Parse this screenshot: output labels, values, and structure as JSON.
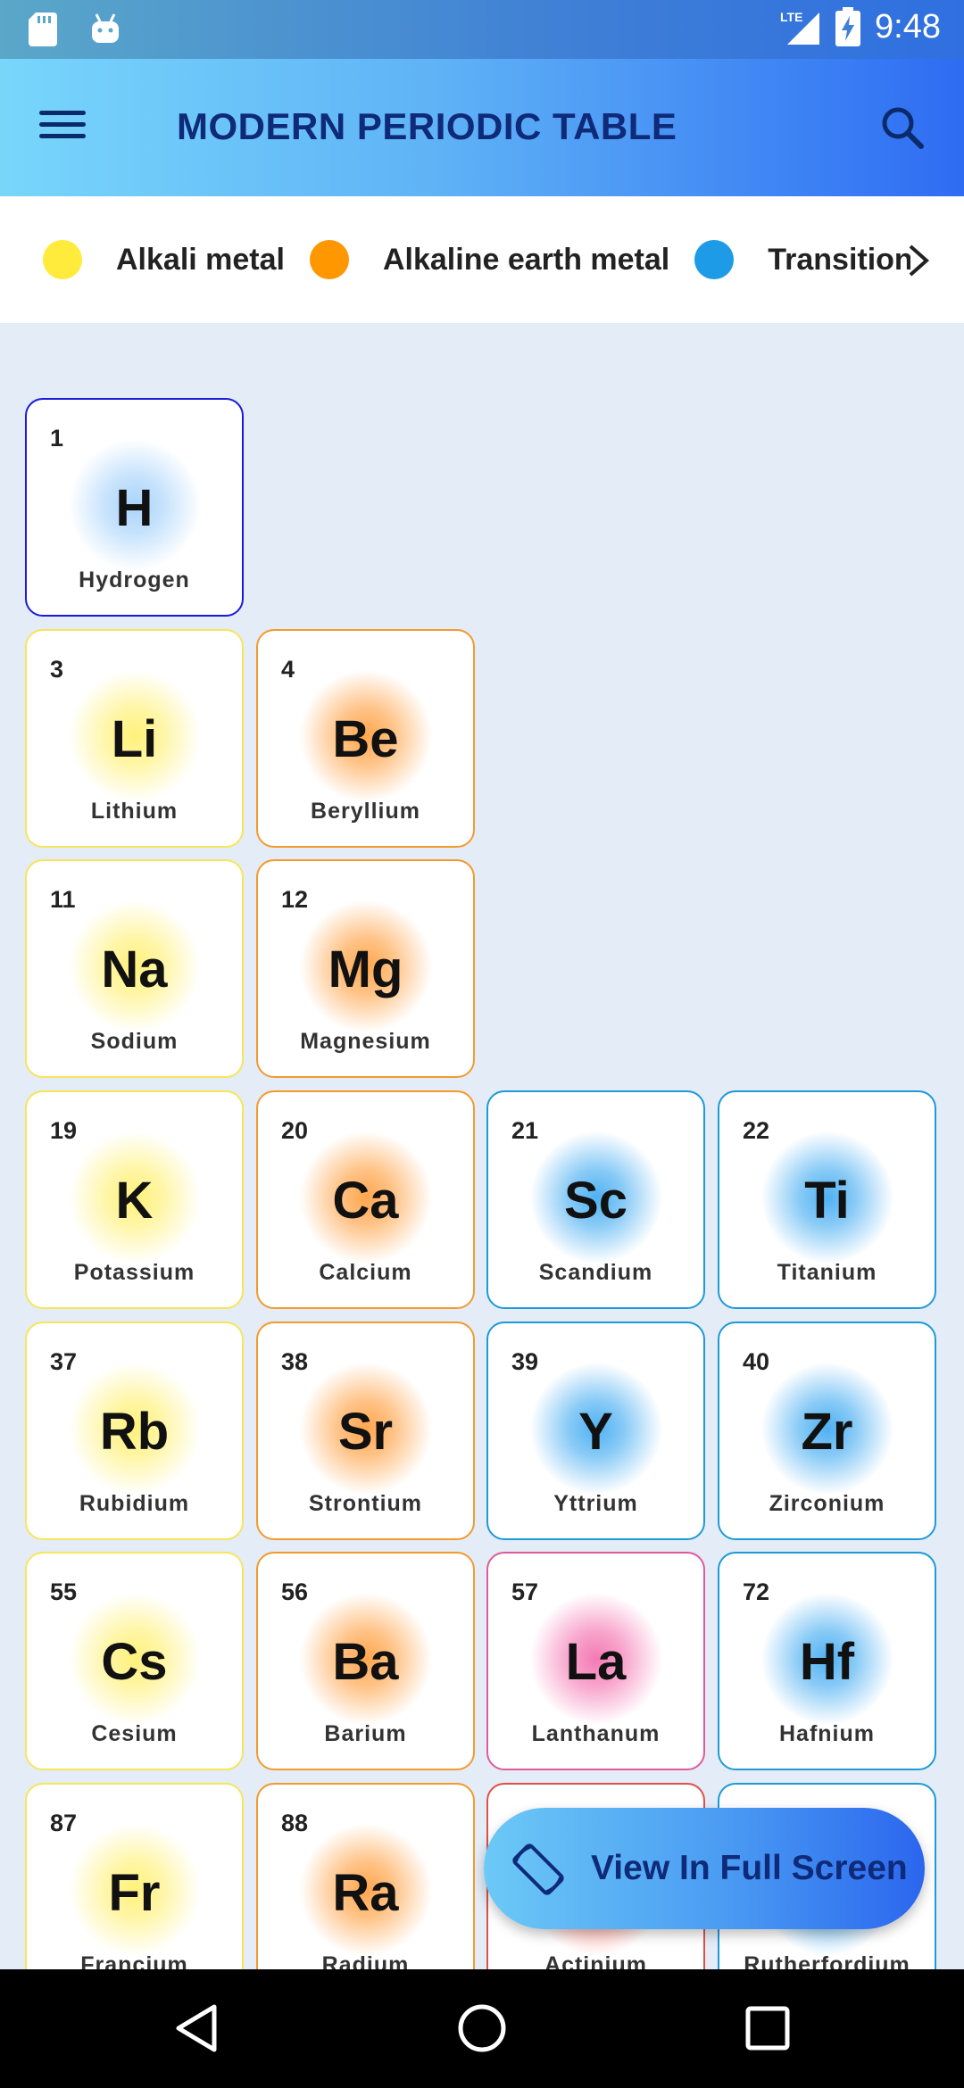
{
  "status_bar": {
    "time": "9:48",
    "network": "LTE",
    "left_icons": [
      "sd-card-icon",
      "android-icon"
    ],
    "right_icons": [
      "signal-icon",
      "battery-charging-icon"
    ]
  },
  "app_bar": {
    "title": "MODERN PERIODIC TABLE",
    "menu_icon": "hamburger-menu-icon",
    "search_icon": "search-icon",
    "gradient": [
      "#78d6fb",
      "#2e6cf3"
    ]
  },
  "legend": {
    "items": [
      {
        "label": "Alkali metal",
        "color": "#ffeb3b"
      },
      {
        "label": "Alkaline earth metal",
        "color": "#ff9800"
      },
      {
        "label": "Transition me",
        "color": "#1e9be6"
      }
    ],
    "scroll_icon": "chevron-right-icon"
  },
  "category_colors": {
    "nonmetal": {
      "border": "#1a1adb",
      "glow": "#a9d4fb"
    },
    "alkali": {
      "border": "#f7e55b",
      "glow": "#fff17a"
    },
    "alkaline": {
      "border": "#f39a2e",
      "glow": "#ffa64d"
    },
    "transition": {
      "border": "#1e9ad6",
      "glow": "#4fb1f2"
    },
    "lanthanide": {
      "border": "#e05a9a",
      "glow": "#f47ab4"
    },
    "actinide": {
      "border": "#e0504a",
      "glow": "#ff8a80"
    }
  },
  "elements": [
    {
      "number": "1",
      "symbol": "H",
      "name": "Hydrogen",
      "category": "nonmetal",
      "col": 0,
      "row": 0
    },
    {
      "number": "3",
      "symbol": "Li",
      "name": "Lithium",
      "category": "alkali",
      "col": 0,
      "row": 1
    },
    {
      "number": "4",
      "symbol": "Be",
      "name": "Beryllium",
      "category": "alkaline",
      "col": 1,
      "row": 1
    },
    {
      "number": "11",
      "symbol": "Na",
      "name": "Sodium",
      "category": "alkali",
      "col": 0,
      "row": 2
    },
    {
      "number": "12",
      "symbol": "Mg",
      "name": "Magnesium",
      "category": "alkaline",
      "col": 1,
      "row": 2
    },
    {
      "number": "19",
      "symbol": "K",
      "name": "Potassium",
      "category": "alkali",
      "col": 0,
      "row": 3
    },
    {
      "number": "20",
      "symbol": "Ca",
      "name": "Calcium",
      "category": "alkaline",
      "col": 1,
      "row": 3
    },
    {
      "number": "21",
      "symbol": "Sc",
      "name": "Scandium",
      "category": "transition",
      "col": 2,
      "row": 3
    },
    {
      "number": "22",
      "symbol": "Ti",
      "name": "Titanium",
      "category": "transition",
      "col": 3,
      "row": 3
    },
    {
      "number": "37",
      "symbol": "Rb",
      "name": "Rubidium",
      "category": "alkali",
      "col": 0,
      "row": 4
    },
    {
      "number": "38",
      "symbol": "Sr",
      "name": "Strontium",
      "category": "alkaline",
      "col": 1,
      "row": 4
    },
    {
      "number": "39",
      "symbol": "Y",
      "name": "Yttrium",
      "category": "transition",
      "col": 2,
      "row": 4
    },
    {
      "number": "40",
      "symbol": "Zr",
      "name": "Zirconium",
      "category": "transition",
      "col": 3,
      "row": 4
    },
    {
      "number": "55",
      "symbol": "Cs",
      "name": "Cesium",
      "category": "alkali",
      "col": 0,
      "row": 5
    },
    {
      "number": "56",
      "symbol": "Ba",
      "name": "Barium",
      "category": "alkaline",
      "col": 1,
      "row": 5
    },
    {
      "number": "57",
      "symbol": "La",
      "name": "Lanthanum",
      "category": "lanthanide",
      "col": 2,
      "row": 5
    },
    {
      "number": "72",
      "symbol": "Hf",
      "name": "Hafnium",
      "category": "transition",
      "col": 3,
      "row": 5
    },
    {
      "number": "87",
      "symbol": "Fr",
      "name": "Francium",
      "category": "alkali",
      "col": 0,
      "row": 6
    },
    {
      "number": "88",
      "symbol": "Ra",
      "name": "Radium",
      "category": "alkaline",
      "col": 1,
      "row": 6
    },
    {
      "number": "",
      "symbol": "",
      "name": "Actinium",
      "category": "actinide",
      "col": 2,
      "row": 6
    },
    {
      "number": "",
      "symbol": "",
      "name": "Rutherfordium",
      "category": "transition",
      "col": 3,
      "row": 6
    }
  ],
  "fab": {
    "label": "View In Full Screen",
    "icon": "screen-rotation-icon"
  },
  "nav_bar": {
    "back_icon": "back-triangle-icon",
    "home_icon": "home-circle-icon",
    "recents_icon": "recents-square-icon"
  }
}
